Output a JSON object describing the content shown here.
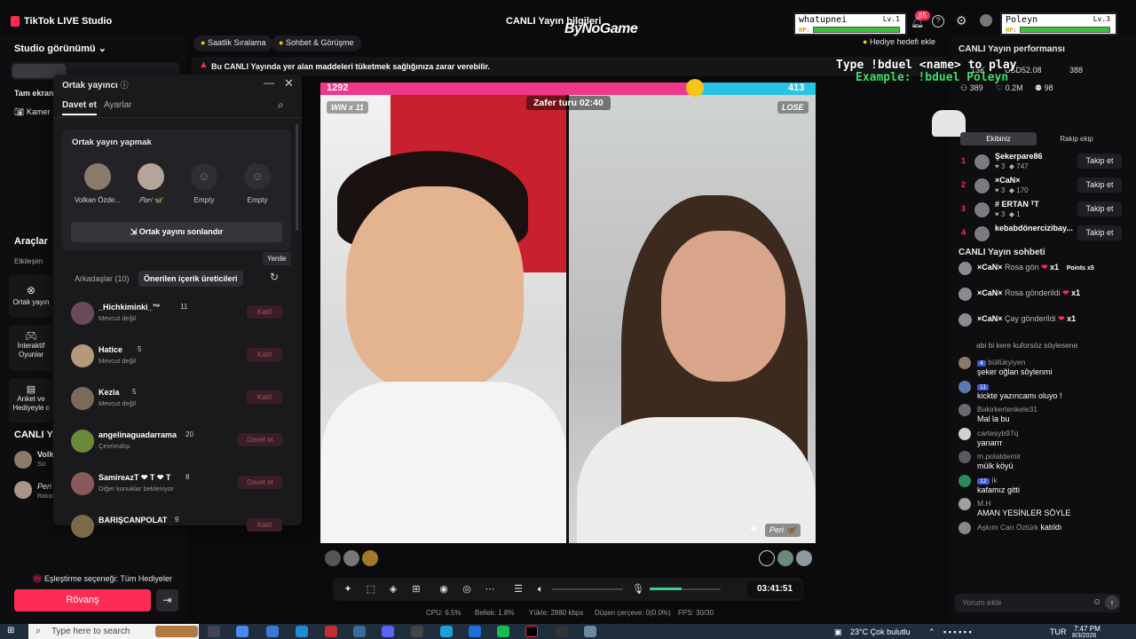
{
  "app": {
    "title": "TikTok LIVE Studio",
    "center_title": "CANLI Yayın bilgileri",
    "watermark": "ByNoGame"
  },
  "players": [
    {
      "name": "whatupnei",
      "level": "Lv.1",
      "hp_label": "HP:",
      "hp": 0.9
    },
    {
      "name": "Poleyn",
      "level": "Lv.3",
      "hp_label": "HP:",
      "hp": 0.9
    }
  ],
  "header": {
    "notif_count": "65",
    "goal_button": "Hediye hedefi ekle"
  },
  "sidebar": {
    "studio_view": "Studio görünümü",
    "screen_label": "Tam ekran",
    "camera_label": "Kamer",
    "tools_heading": "Araçlar",
    "engagement_label": "Etkileşim",
    "tools": [
      "Ortak yayın",
      "İnteraktif Oyunlar",
      "Anket ve Hediyeyle c"
    ],
    "live_heading": "CANLI Yayı",
    "live_users": [
      {
        "name": "Volk",
        "sub": "Siz"
      },
      {
        "name": "Peri",
        "sub": "Rakip"
      }
    ],
    "match_option": "Eşleştirme seçeneği: Tüm Hediyeler",
    "rematch": "Rövanş"
  },
  "topbar": {
    "pills": [
      "Saatlik Sıralama",
      "Sohbet & Görüşme"
    ],
    "warning": "Bu CANLI Yayında yer alan maddeleri tüketmek sağlığınıza zarar verebilir."
  },
  "popup": {
    "title": "Ortak yayıncı",
    "tabs": [
      "Davet et",
      "Ayarlar"
    ],
    "section_title": "Ortak yayın yapmak",
    "slots": [
      {
        "label": "Volkan Özde..."
      },
      {
        "label": "𝑃𝑒𝑟𝑖 🦋"
      },
      {
        "label": "Empty"
      },
      {
        "label": "Empty"
      }
    ],
    "end_button": "Ortak yayını sonlandır",
    "list_tabs": [
      "Arkadaşlar (10)",
      "Önerilen içerik üreticileri"
    ],
    "refresh_tooltip": "Yenile",
    "rows": [
      {
        "name": "_Hichkiminki_™",
        "count": "11",
        "status": "Mevcut değil",
        "action": "Katıl"
      },
      {
        "name": "Hatice",
        "count": "5",
        "status": "Mevcut değil",
        "action": "Katıl"
      },
      {
        "name": "Kezia",
        "count": "5",
        "status": "Mevcut değil",
        "action": "Katıl"
      },
      {
        "name": "angelinaguadarrama",
        "count": "20",
        "status": "Çevrimdışı",
        "action": "Davet et"
      },
      {
        "name": "SamireᴀzT ❤ T ❤ T",
        "count": "8",
        "status": "Diğer konuklar bekleniyor",
        "action": "Davet et"
      },
      {
        "name": "BARIŞCANPOLAT",
        "count": "9",
        "status": "",
        "action": "Katıl"
      }
    ]
  },
  "battle": {
    "left_score": "1292",
    "right_score": "413",
    "left_fraction": 0.757,
    "win_label": "WIN x 11",
    "lose_label": "LOSE",
    "timer": "Zafer turu 02:40",
    "opponent_tag": "Peri 🦋"
  },
  "overlay": {
    "line1": "Type !bduel <name> to play",
    "line2": "Example: !bduel Poleyn"
  },
  "controls": {
    "clock": "03:41:51"
  },
  "stats": {
    "cpu": "CPU: 6.5%",
    "memory": "Bellek: 1.8%",
    "upload": "Yükle: 2880 kbps",
    "dropped": "Düşen çerçeve: 0(0.0%)",
    "fps": "FPS: 30/30"
  },
  "right": {
    "perf_title": "CANLI Yayın performansı",
    "metrics": [
      "13K",
      "USD52.08",
      "388",
      "389",
      "0.2M",
      "98"
    ],
    "tabs": [
      "Ekibiniz",
      "Rakip ekip"
    ],
    "leaders": [
      {
        "rank": "1",
        "name": "Şekerpare86",
        "lvl": "3",
        "score": "747",
        "btn": "Takip et"
      },
      {
        "rank": "2",
        "name": "×CaN×",
        "lvl": "3",
        "score": "170",
        "btn": "Takip et"
      },
      {
        "rank": "3",
        "name": "# ERTAN ᵀT",
        "lvl": "3",
        "score": "1",
        "btn": "Takip et"
      },
      {
        "rank": "4",
        "name": "kebabdönercizibay...",
        "lvl": "",
        "score": "",
        "btn": "Takip et"
      }
    ],
    "chat_title": "CANLI Yayın sohbeti",
    "gifts": [
      {
        "user": "×CaN×",
        "text": "Rosa gön",
        "mult": "x1",
        "points": "Points x5"
      },
      {
        "user": "×CaN×",
        "text": "Rosa gönderildi",
        "mult": "x1"
      },
      {
        "user": "×CaN×",
        "text": "Çay gönderildi",
        "mult": "x1"
      }
    ],
    "chat_partial": "abi bi kere kuforsöz söylesene",
    "chat": [
      {
        "lvl": "4",
        "user": "büllükyiyen",
        "msg": "şeker oğlan söylenmi"
      },
      {
        "lvl": "11",
        "user": "",
        "msg": "kickte yazıncamı oluyo !"
      },
      {
        "lvl": "",
        "user": "Bakirkertenkele31",
        "msg": "Mal la bu"
      },
      {
        "lvl": "",
        "user": "cartesyb97q",
        "msg": "yanarrr"
      },
      {
        "lvl": "",
        "user": "m.polatdemir",
        "msg": "mülk köyü"
      },
      {
        "lvl": "12",
        "user": "Ik",
        "msg": "kafamız gitti"
      },
      {
        "lvl": "",
        "user": "M.H",
        "msg": "AMAN YESİNLER SÖYLE"
      },
      {
        "lvl": "",
        "user": "Aşkım Can Öztürk",
        "msg": "katıldı"
      }
    ],
    "comment_placeholder": "Yorum ekle"
  },
  "taskbar": {
    "search": "Type here to search",
    "weather": "23°C  Çok bulutlu",
    "lang": "TUR",
    "time": "7:47 PM",
    "date": "8/3/2026"
  },
  "colors": {
    "accent": "#fe2c55",
    "cyan": "#29c3e6",
    "bg": "#0b0b0d"
  }
}
